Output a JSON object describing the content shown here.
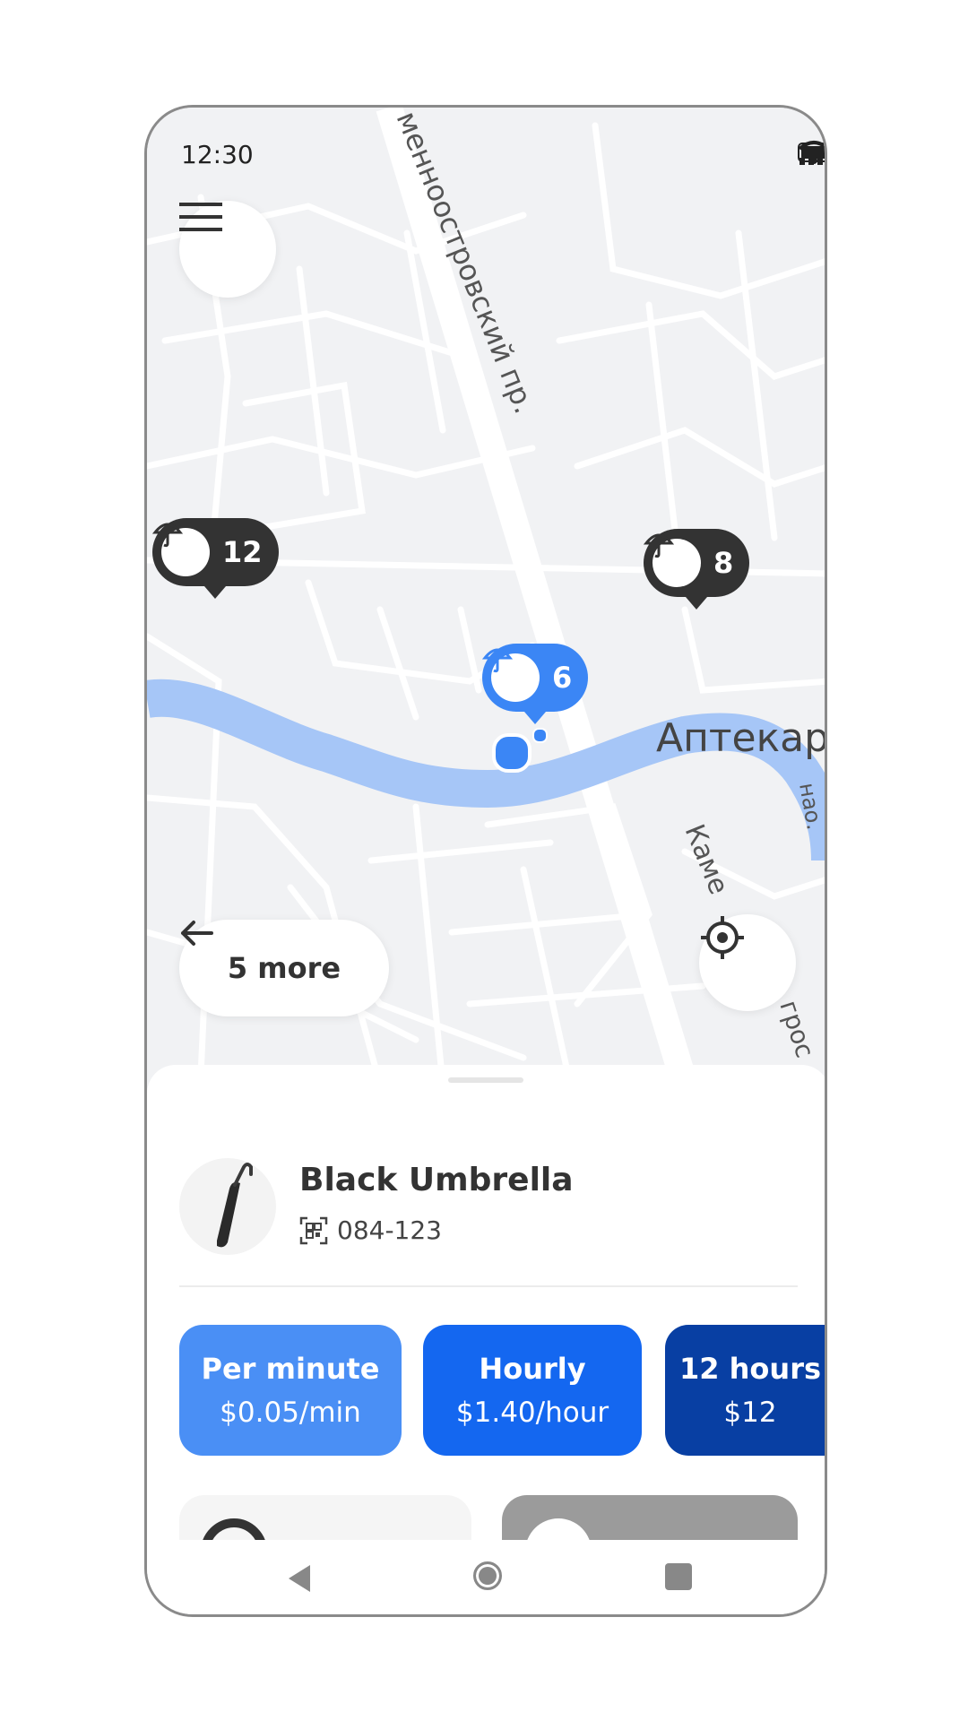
{
  "status_bar": {
    "time": "12:30",
    "icons": [
      "signal-icon",
      "wifi-icon",
      "battery-icon"
    ]
  },
  "map": {
    "street_labels": [
      "менноостровский пр.",
      "Аптекар",
      "Каме",
      "нао.",
      "грос"
    ],
    "pins": [
      {
        "count": "12",
        "style": "dark"
      },
      {
        "count": "8",
        "style": "dark"
      },
      {
        "count": "6",
        "style": "selected"
      }
    ]
  },
  "controls": {
    "more_label": "5 more",
    "menu_icon": "hamburger-icon",
    "locate_icon": "crosshair-icon"
  },
  "item": {
    "name": "Black Umbrella",
    "code": "084-123",
    "code_icon": "qr-code-icon"
  },
  "plans": [
    {
      "title": "Per minute",
      "price": "$0.05/min",
      "color": "#4a8ff5"
    },
    {
      "title": "Hourly",
      "price": "$1.40/hour",
      "color": "#1467f0"
    },
    {
      "title": "12 hours",
      "price": "$12",
      "color": "#083fa3"
    }
  ],
  "colors": {
    "accent": "#3b86f5",
    "river": "#a6c6f7",
    "pin_dark": "#333333"
  }
}
